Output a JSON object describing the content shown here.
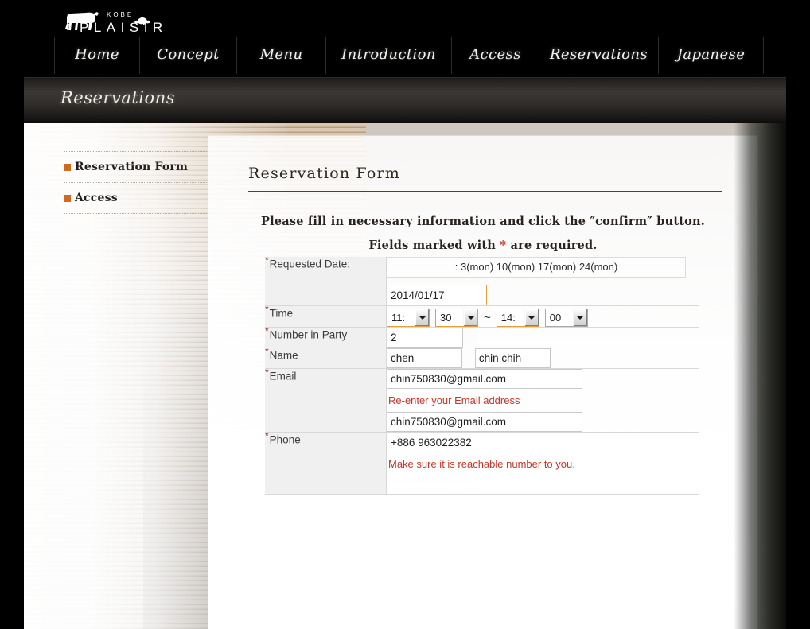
{
  "site": {
    "logo_kobe": "KOBE",
    "logo_plaisir": "PLAISIR",
    "logo_alt": "cow-logo"
  },
  "nav": {
    "items": [
      {
        "label": "Home",
        "key": "home"
      },
      {
        "label": "Concept",
        "key": "concept"
      },
      {
        "label": "Menu",
        "key": "menu"
      },
      {
        "label": "Introduction",
        "key": "introduction"
      },
      {
        "label": "Access",
        "key": "access"
      },
      {
        "label": "Reservations",
        "key": "reservations"
      },
      {
        "label": "Japanese",
        "key": "japanese"
      }
    ]
  },
  "page": {
    "banner_title": "Reservations"
  },
  "sidebar": {
    "items": [
      {
        "label": "Reservation Form"
      },
      {
        "label": "Access"
      }
    ]
  },
  "form": {
    "title": "Reservation Form",
    "intro_line1": "Please fill in necessary information and click the ″confirm″ button.",
    "intro_line2_prefix": "Fields marked with ",
    "intro_line2_star": "*",
    "intro_line2_suffix": " are required.",
    "rows": {
      "date": {
        "label": "Requested Date:",
        "note": ": 3(mon) 10(mon) 17(mon) 24(mon)",
        "value": "2014/01/17"
      },
      "time": {
        "label": "Time",
        "start_hour": "11:",
        "start_minute": "30",
        "separator": "~",
        "end_hour": "14:",
        "end_minute": "00"
      },
      "party": {
        "label": "Number in Party",
        "value": "2"
      },
      "name": {
        "label": "Name",
        "last_value": "chen",
        "first_value": "chin chih"
      },
      "email": {
        "label": "Email",
        "value": "chin750830@gmail.com",
        "hint": "Re-enter your Email address",
        "confirm_value": "chin750830@gmail.com"
      },
      "phone": {
        "label": "Phone",
        "value": "+886 963022382",
        "hint": "Make sure it is reachable number to you."
      }
    }
  },
  "colors": {
    "accent_orange": "#d2691e",
    "focus_border": "#e0a040",
    "hint_red": "#c0392b",
    "star_red": "#8b1a1a"
  }
}
